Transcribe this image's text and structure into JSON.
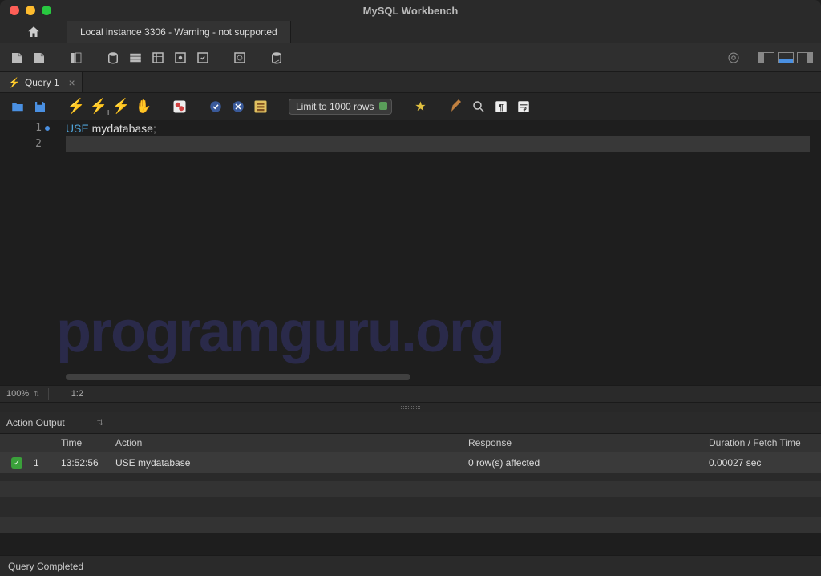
{
  "window": {
    "title": "MySQL Workbench"
  },
  "connection_tab": {
    "label": "Local instance 3306 - Warning - not supported"
  },
  "query_tab": {
    "label": "Query 1"
  },
  "editor_toolbar": {
    "limit_label": "Limit to 1000 rows"
  },
  "editor": {
    "lines": {
      "l1_kw": "USE",
      "l1_rest": " mydatabase",
      "l1_semi": ";"
    },
    "watermark": "programguru.org"
  },
  "editor_status": {
    "zoom": "100%",
    "position": "1:2"
  },
  "output": {
    "section_label": "Action Output",
    "columns": {
      "time": "Time",
      "action": "Action",
      "response": "Response",
      "duration": "Duration / Fetch Time"
    },
    "rows": [
      {
        "idx": "1",
        "time": "13:52:56",
        "action": "USE mydatabase",
        "response": "0 row(s) affected",
        "duration": "0.00027 sec"
      }
    ]
  },
  "statusbar": {
    "message": "Query Completed"
  }
}
